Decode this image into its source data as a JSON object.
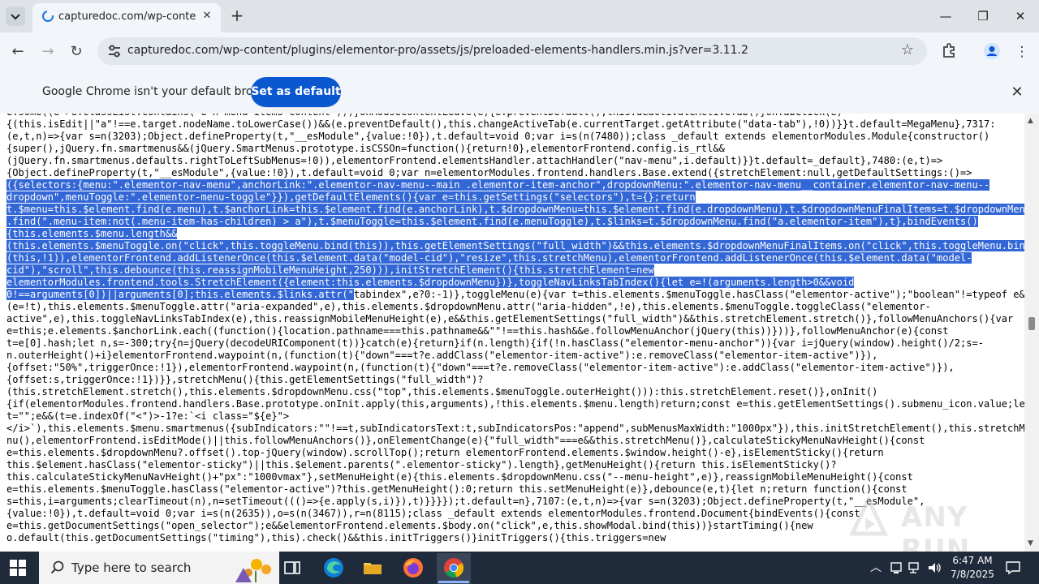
{
  "browser": {
    "tab_title": "capturedoc.com/wp-content/pl",
    "url": "capturedoc.com/wp-content/plugins/elementor-pro/assets/js/preloaded-elements-handlers.min.js?ver=3.11.2"
  },
  "infobar": {
    "message": "Google Chrome isn't your default browser",
    "button_label": "Set as default"
  },
  "code": {
    "lines": [
      "e.some((e=>e.classList.contains(\"e-n-menu-items-content\")))}onMouseContentLeave(e){e.preventDefault(),this.deactivateActiveTab()}onTabClick(e)",
      "{(this.isEdit||\"a\"!==e.target.nodeName.toLowerCase())&&(e.preventDefault(),this.changeActiveTab(e.currentTarget.getAttribute(\"data-tab\"),!0))}}t.default=MegaMenu},7317:",
      "(e,t,n)=>{var s=n(3203);Object.defineProperty(t,\"__esModule\",{value:!0}),t.default=void 0;var i=s(n(7480));class _default extends elementorModules.Module{constructor()",
      "{super(),jQuery.fn.smartmenus&&(jQuery.SmartMenus.prototype.isCSSOn=function(){return!0},elementorFrontend.config.is_rtl&&",
      "(jQuery.fn.smartmenus.defaults.rightToLeftSubMenus=!0)),elementorFrontend.elementsHandler.attachHandler(\"nav-menu\",i.default)}}t.default=_default},7480:(e,t)=>",
      "{Object.defineProperty(t,\"__esModule\",{value:!0}),t.default=void 0;var n=elementorModules.frontend.handlers.Base.extend({stretchElement:null,getDefaultSettings:()=>"
    ],
    "highlighted_lines": [
      "({selectors:{menu:\".elementor-nav-menu\",anchorLink:\".elementor-nav-menu--main .elementor-item-anchor\",dropdownMenu:\".elementor-nav-menu__container.elementor-nav-menu--",
      "dropdown\",menuToggle:\".elementor-menu-toggle\"}}),getDefaultElements(){var e=this.getSettings(\"selectors\"),t={};return",
      "t.$menu=this.$element.find(e.menu),t.$anchorLink=this.$element.find(e.anchorLink),t.$dropdownMenu=this.$element.find(e.dropdownMenu),t.$dropdownMenuFinalItems=t.$dropdownMenu",
      ".find(\".menu-item:not(.menu-item-has-children) > a\"),t.$menuToggle=this.$element.find(e.menuToggle),t.$links=t.$dropdownMenu.find(\"a.elementor-item\"),t},bindEvents()",
      "{this.elements.$menu.length&&",
      "(this.elements.$menuToggle.on(\"click\",this.toggleMenu.bind(this)),this.getElementSettings(\"full_width\")&&this.elements.$dropdownMenuFinalItems.on(\"click\",this.toggleMenu.bind",
      "(this,!1)),elementorFrontend.addListenerOnce(this.$element.data(\"model-cid\"),\"resize\",this.stretchMenu),elementorFrontend.addListenerOnce(this.$element.data(\"model-",
      "cid\"),\"scroll\",this.debounce(this.reassignMobileMenuHeight,250))),initStretchElement(){this.stretchElement=new",
      "elementorModules.frontend.tools.StretchElement({element:this.elements.$dropdownMenu})},toggleNavLinksTabIndex(){let e=!(arguments.length>0&&void",
      "0!==arguments[0])||arguments[0];this.elements.$links.attr(\""
    ],
    "highlight_tail": "tabindex\",e?0:-1)},toggleMenu(e){var t=this.elements.$menuToggle.hasClass(\"elementor-active\");\"boolean\"!=typeof e&&",
    "rest_lines": [
      "(e=!t),this.elements.$menuToggle.attr(\"aria-expanded\",e),this.elements.$dropdownMenu.attr(\"aria-hidden\",!e),this.elements.$menuToggle.toggleClass(\"elementor-",
      "active\",e),this.toggleNavLinksTabIndex(e),this.reassignMobileMenuHeight(e),e&&this.getElementSettings(\"full_width\")&&this.stretchElement.stretch()},followMenuAnchors(){var",
      "e=this;e.elements.$anchorLink.each((function(){location.pathname===this.pathname&&\"\"!==this.hash&&e.followMenuAnchor(jQuery(this))}))},followMenuAnchor(e){const",
      "t=e[0].hash;let n,s=-300;try{n=jQuery(decodeURIComponent(t))}catch(e){return}if(n.length){if(!n.hasClass(\"elementor-menu-anchor\")){var i=jQuery(window).height()/2;s=-",
      "n.outerHeight()+i}elementorFrontend.waypoint(n,(function(t){\"down\"===t?e.addClass(\"elementor-item-active\"):e.removeClass(\"elementor-item-active\")}),",
      "{offset:\"50%\",triggerOnce:!1}),elementorFrontend.waypoint(n,(function(t){\"down\"===t?e.removeClass(\"elementor-item-active\"):e.addClass(\"elementor-item-active\")}),",
      "{offset:s,triggerOnce:!1})}},stretchMenu(){this.getElementSettings(\"full_width\")?",
      "(this.stretchElement.stretch(),this.elements.$dropdownMenu.css(\"top\",this.elements.$menuToggle.outerHeight())):this.stretchElement.reset()},onInit()",
      "{if(elementorModules.frontend.handlers.Base.prototype.onInit.apply(this,arguments),!this.elements.$menu.length)return;const e=this.getElementSettings().submenu_icon.value;let",
      "t=\"\";e&&(t=e.indexOf(\"<\")>-1?e:`<i class=\"${e}\">",
      "</i>`),this.elements.$menu.smartmenus({subIndicators:\"\"!==t,subIndicatorsText:t,subIndicatorsPos:\"append\",subMenusMaxWidth:\"1000px\"}),this.initStretchElement(),this.stretchMe",
      "nu(),elementorFrontend.isEditMode()||this.followMenuAnchors()},onElementChange(e){\"full_width\"===e&&this.stretchMenu()},calculateStickyMenuNavHeight(){const",
      "e=this.elements.$dropdownMenu?.offset().top-jQuery(window).scrollTop();return elementorFrontend.elements.$window.height()-e},isElementSticky(){return",
      "this.$element.hasClass(\"elementor-sticky\")||this.$element.parents(\".elementor-sticky\").length},getMenuHeight(){return this.isElementSticky()?",
      "this.calculateStickyMenuNavHeight()+\"px\":\"1000vmax\"},setMenuHeight(e){this.elements.$dropdownMenu.css(\"--menu-height\",e)},reassignMobileMenuHeight(){const",
      "e=this.elements.$menuToggle.hasClass(\"elementor-active\")?this.getMenuHeight():0;return this.setMenuHeight(e)},debounce(e,t){let n;return function(){const",
      "s=this,i=arguments;clearTimeout(n),n=setTimeout((()=>{e.apply(s,i)}),t)}}}});t.default=n},7107:(e,t,n)=>{var s=n(3203);Object.defineProperty(t,\"__esModule\",",
      "{value:!0}),t.default=void 0;var i=s(n(2635)),o=s(n(3467)),r=n(8115);class _default extends elementorModules.frontend.Document{bindEvents(){const",
      "e=this.getDocumentSettings(\"open_selector\");e&&elementorFrontend.elements.$body.on(\"click\",e,this.showModal.bind(this))}startTiming(){new",
      "o.default(this.getDocumentSettings(\"timing\"),this).check()&&this.initTriggers()}initTriggers(){this.triggers=new"
    ]
  },
  "taskbar": {
    "search_placeholder": "Type here to search",
    "time": "6:47 AM",
    "date": "7/8/2025"
  },
  "watermark": "ANY RUN"
}
